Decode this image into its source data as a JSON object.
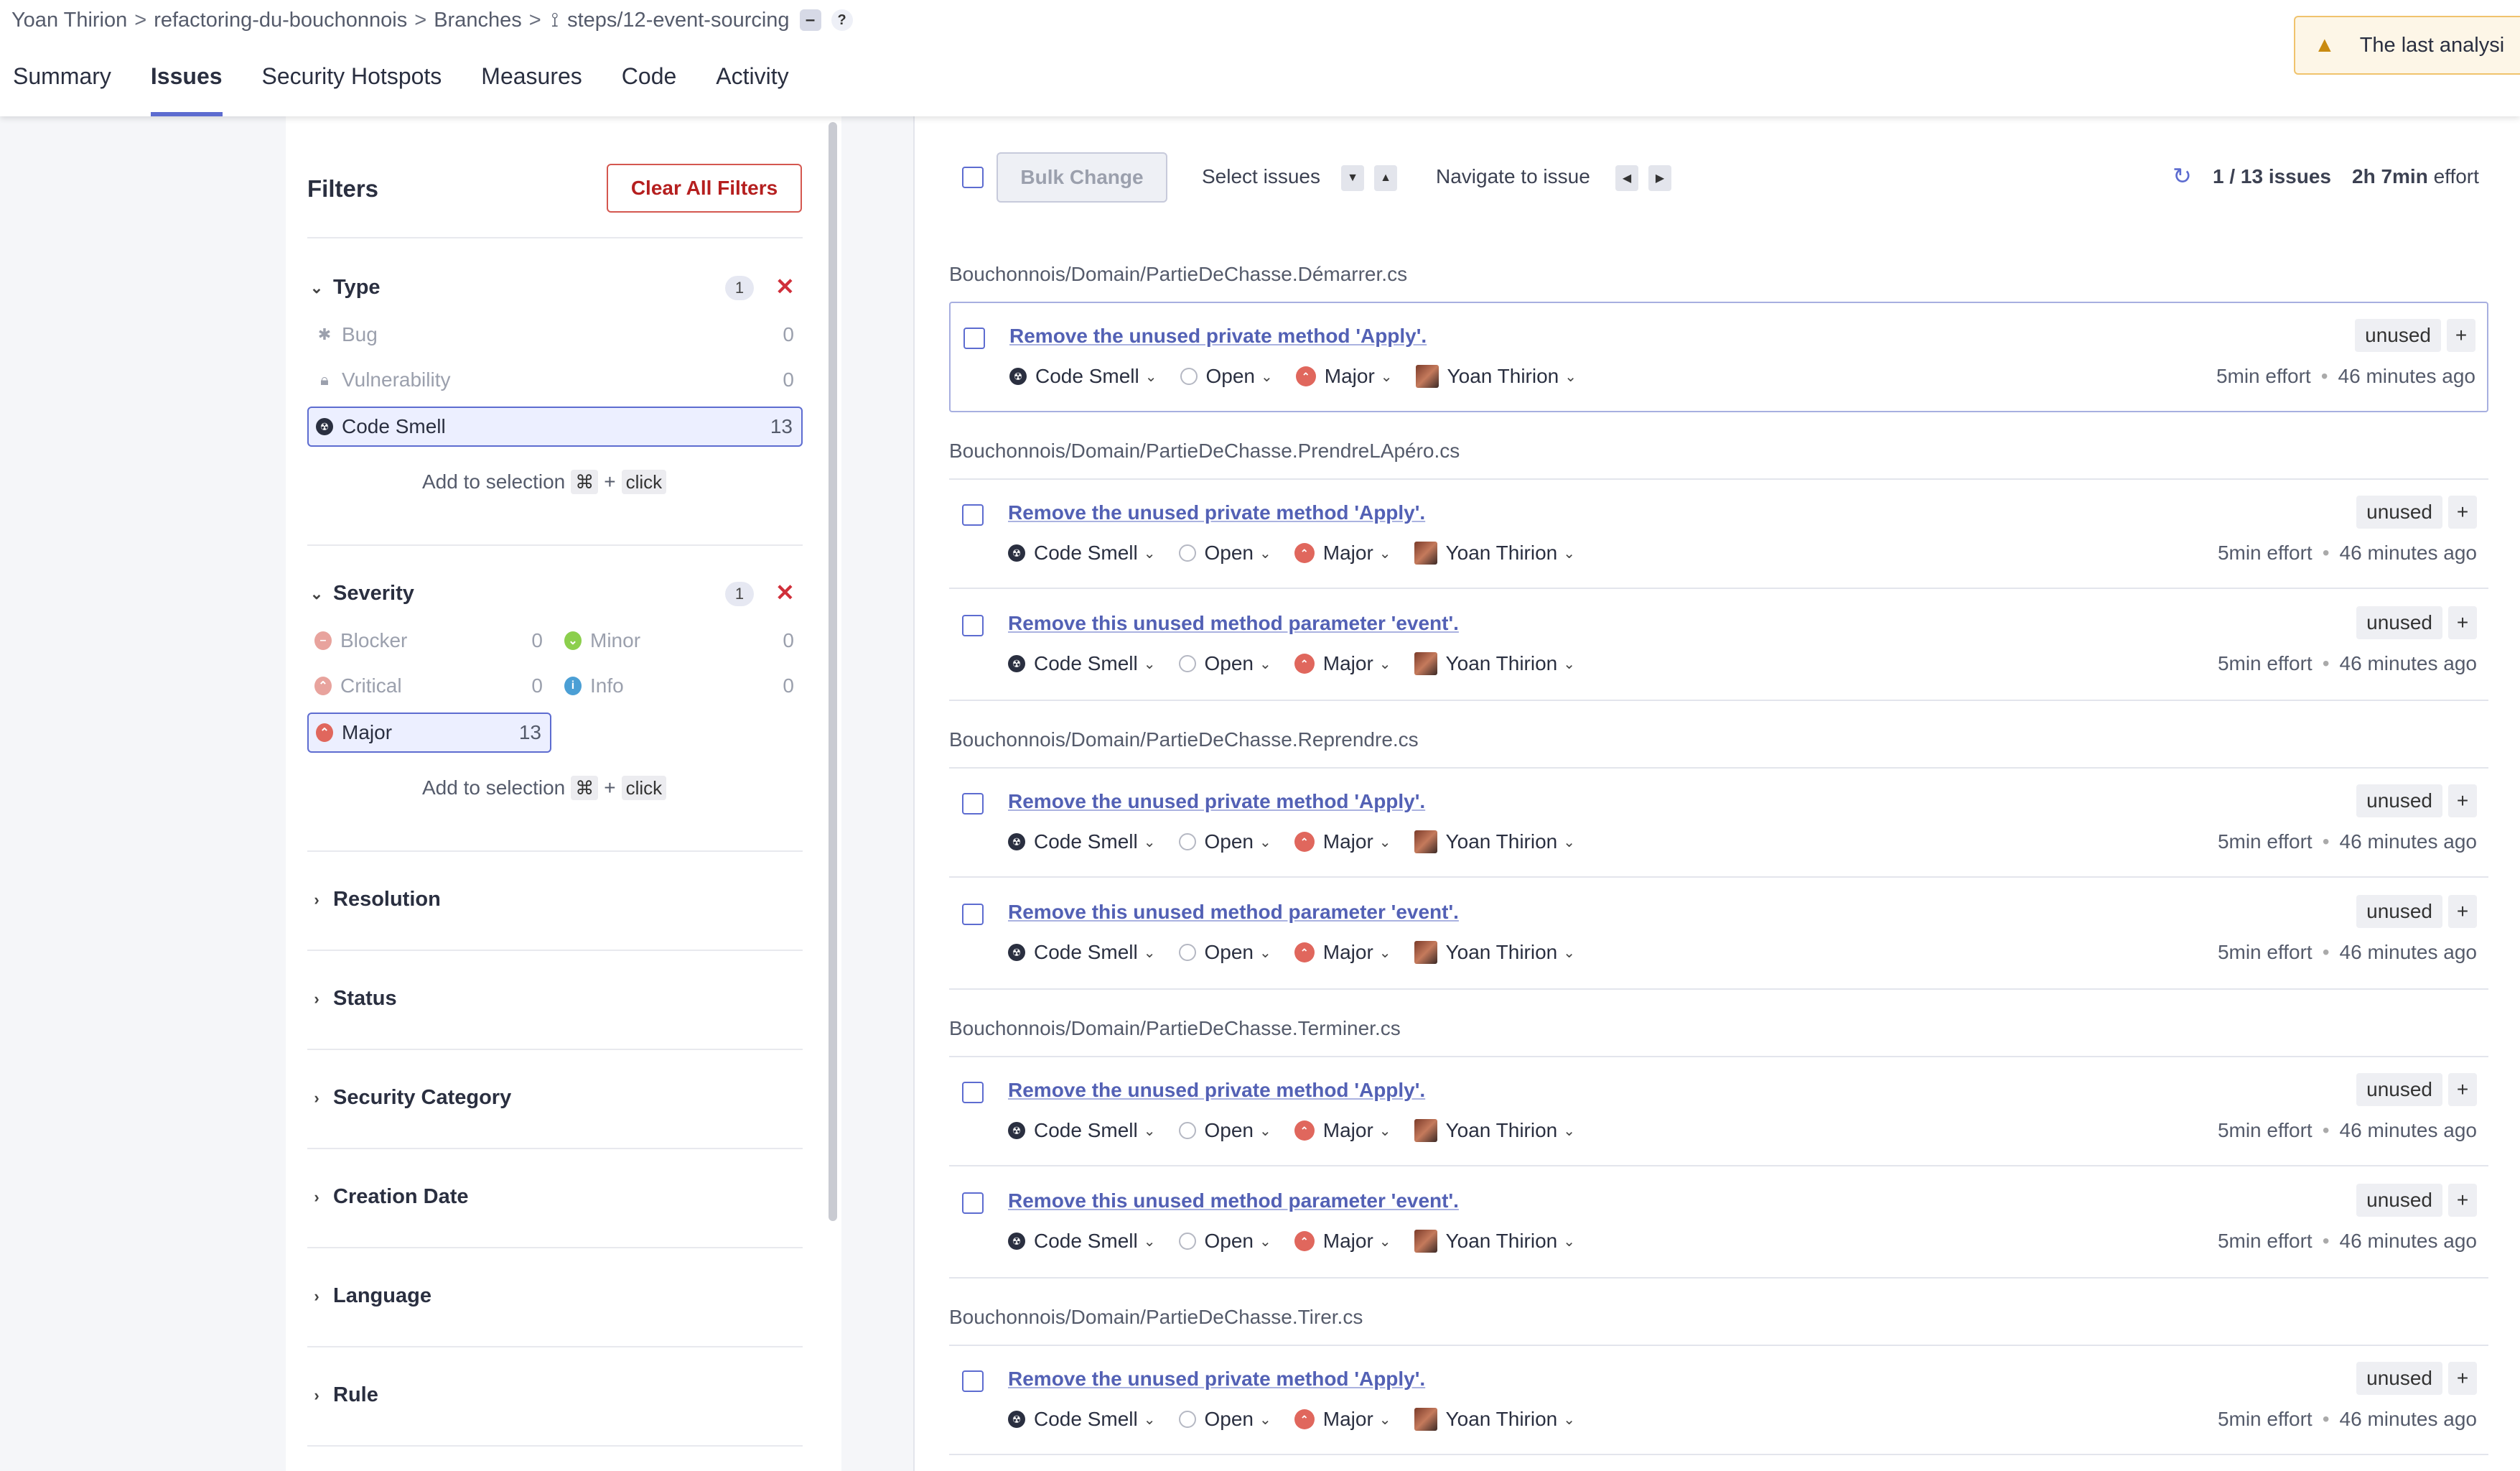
{
  "breadcrumb": {
    "owner": "Yoan Thirion",
    "project": "refactoring-du-bouchonnois",
    "branches": "Branches",
    "branch": "steps/12-event-sourcing",
    "help": "?"
  },
  "nav_tabs": [
    {
      "label": "Summary"
    },
    {
      "label": "Issues"
    },
    {
      "label": "Security Hotspots"
    },
    {
      "label": "Measures"
    },
    {
      "label": "Code"
    },
    {
      "label": "Activity"
    }
  ],
  "warning": {
    "text": "The last analysi"
  },
  "filters": {
    "title": "Filters",
    "clear_all": "Clear All Filters",
    "add_to_selection": "Add to selection",
    "key_cmd": "⌘",
    "key_plus": "+",
    "key_click": "click",
    "type": {
      "label": "Type",
      "badge": "1",
      "items": [
        {
          "label": "Bug",
          "count": "0"
        },
        {
          "label": "Vulnerability",
          "count": "0"
        },
        {
          "label": "Code Smell",
          "count": "13"
        }
      ]
    },
    "severity": {
      "label": "Severity",
      "badge": "1",
      "items": [
        {
          "label": "Blocker",
          "count": "0"
        },
        {
          "label": "Minor",
          "count": "0"
        },
        {
          "label": "Critical",
          "count": "0"
        },
        {
          "label": "Info",
          "count": "0"
        },
        {
          "label": "Major",
          "count": "13"
        }
      ]
    },
    "collapsed": [
      {
        "label": "Resolution"
      },
      {
        "label": "Status"
      },
      {
        "label": "Security Category"
      },
      {
        "label": "Creation Date"
      },
      {
        "label": "Language"
      },
      {
        "label": "Rule"
      }
    ]
  },
  "toolbar": {
    "bulk_change": "Bulk Change",
    "select_issues": "Select issues",
    "navigate": "Navigate to issue",
    "count": "1 / 13 issues",
    "effort_value": "2h 7min",
    "effort_label": "effort"
  },
  "issue_common": {
    "type": "Code Smell",
    "status": "Open",
    "severity": "Major",
    "assignee": "Yoan Thirion",
    "tag": "unused",
    "plus": "+",
    "effort": "5min effort",
    "age": "46 minutes ago",
    "dot": "•"
  },
  "files": [
    {
      "path": "Bouchonnois/Domain/PartieDeChasse.Démarrer.cs"
    },
    {
      "path": "Bouchonnois/Domain/PartieDeChasse.PrendreLApéro.cs"
    },
    {
      "path": "Bouchonnois/Domain/PartieDeChasse.Reprendre.cs"
    },
    {
      "path": "Bouchonnois/Domain/PartieDeChasse.Terminer.cs"
    },
    {
      "path": "Bouchonnois/Domain/PartieDeChasse.Tirer.cs"
    }
  ],
  "issues": [
    {
      "message": "Remove the unused private method 'Apply'."
    },
    {
      "message": "Remove the unused private method 'Apply'."
    },
    {
      "message": "Remove this unused method parameter 'event'."
    },
    {
      "message": "Remove the unused private method 'Apply'."
    },
    {
      "message": "Remove this unused method parameter 'event'."
    },
    {
      "message": "Remove the unused private method 'Apply'."
    },
    {
      "message": "Remove this unused method parameter 'event'."
    },
    {
      "message": "Remove the unused private method 'Apply'."
    }
  ],
  "colors": {
    "accent": "#5d6cd0",
    "danger": "#d02f3a",
    "major": "#e0675d",
    "minor": "#8ccf4d",
    "info": "#4b9fd5",
    "warning_bg": "#fdf6e7"
  }
}
